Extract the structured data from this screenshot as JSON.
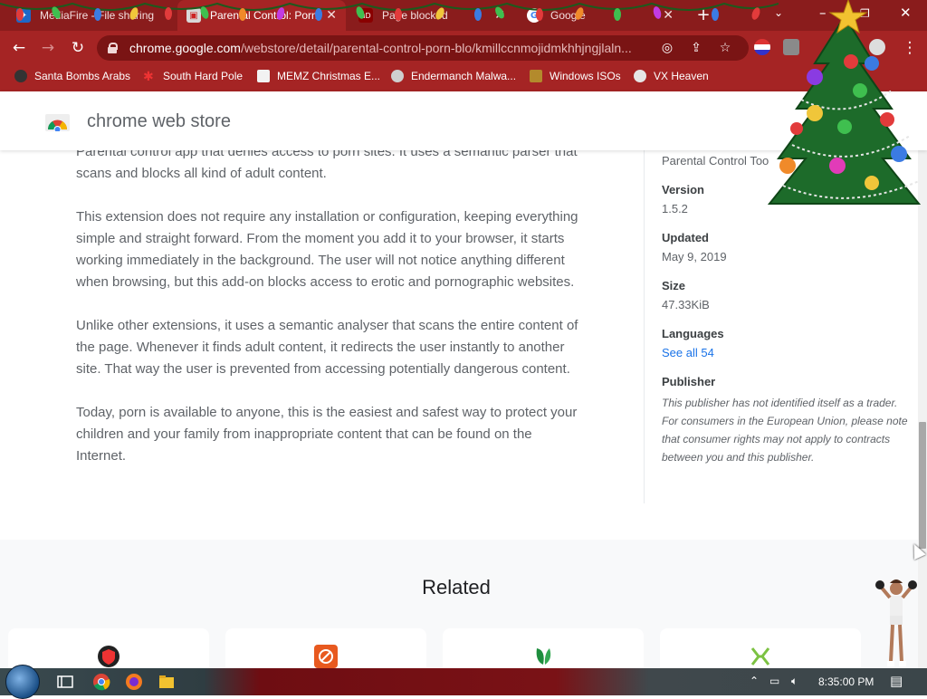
{
  "browser": {
    "tabs": [
      {
        "title": "MediaFire - File sharing",
        "active": false
      },
      {
        "title": "Parental Control: Porn Bl",
        "active": true
      },
      {
        "title": "Page blocked",
        "active": false
      },
      {
        "title": "Google",
        "active": false
      }
    ],
    "url_host": "chrome.google.com",
    "url_path": "/webstore/detail/parental-control-porn-blo/kmillccnmojidmkhhjngjlaln...",
    "bookmarks": [
      {
        "label": "Santa Bombs Arabs",
        "icon": "bomb-icon"
      },
      {
        "label": "South Hard Pole",
        "icon": "snowflake-icon"
      },
      {
        "label": "MEMZ Christmas E...",
        "icon": "gift-icon"
      },
      {
        "label": "Endermanch Malwa...",
        "icon": "mascot-icon"
      },
      {
        "label": "Windows ISOs",
        "icon": "folder-icon"
      },
      {
        "label": "VX Heaven",
        "icon": "skull-icon"
      }
    ],
    "theme_color": "#a52424"
  },
  "store": {
    "brand": "chrome web store",
    "description": [
      "Parental control app that denies access to porn sites. It uses a semantic parser that scans and blocks all kind of adult content.",
      "This extension does not require any installation or configuration, keeping everything simple and straight forward. From the moment you add it to your browser, it starts working immediately in the background. The user will not notice anything different when browsing, but this add-on blocks access to erotic and pornographic websites.",
      "Unlike other extensions, it uses a semantic analyser that scans the entire content of the page. Whenever it finds adult content,  it redirects the user instantly to another site. That way the user is prevented from accessing potentially dangerous content.",
      "Today, porn is available to anyone, this is the easiest and safest way to protect your children and your family from inappropriate content that can be found on the Internet."
    ],
    "meta": {
      "offered_by": "Parental Control Too",
      "version_label": "Version",
      "version": "1.5.2",
      "updated_label": "Updated",
      "updated": "May 9, 2019",
      "size_label": "Size",
      "size": "47.33KiB",
      "languages_label": "Languages",
      "languages_link": "See all 54",
      "publisher_label": "Publisher",
      "publisher_note": "This publisher has not identified itself as a trader. For consumers in the European Union, please note that consumer rights may not apply to contracts between you and this publisher."
    },
    "related_title": "Related"
  },
  "taskbar": {
    "clock": "8:35:00 PM"
  }
}
